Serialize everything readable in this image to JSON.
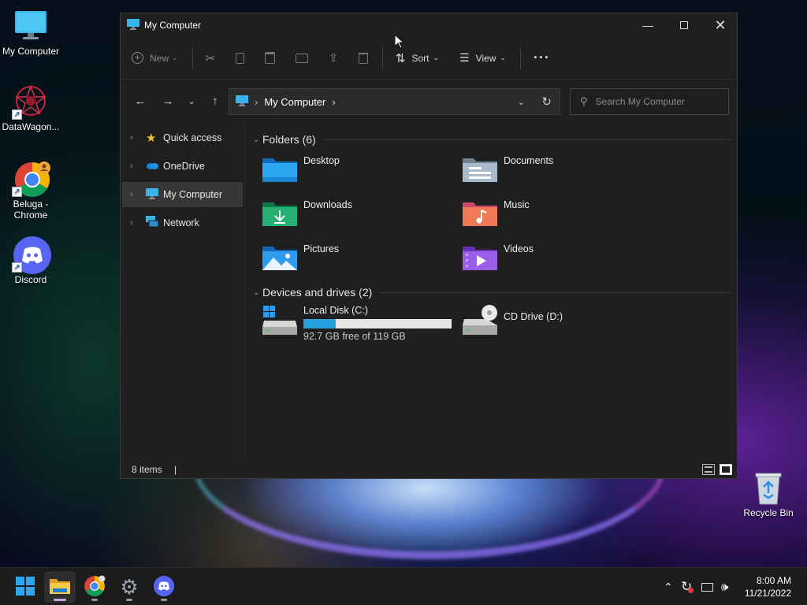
{
  "desktop": {
    "icons": [
      {
        "label": "My Computer",
        "icon": "monitor-icon"
      },
      {
        "label": "DataWagon...",
        "icon": "datawagon-icon"
      },
      {
        "label": "Beluga - Chrome",
        "icon": "chrome-icon"
      },
      {
        "label": "Discord",
        "icon": "discord-icon"
      },
      {
        "label": "Recycle Bin",
        "icon": "recycle-bin-icon"
      }
    ]
  },
  "window": {
    "title": "My Computer",
    "toolbar": {
      "new_label": "New",
      "sort_label": "Sort",
      "view_label": "View",
      "more_label": "···"
    },
    "address": {
      "location": "My Computer",
      "search_placeholder": "Search My Computer"
    },
    "sidebar": {
      "items": [
        {
          "label": "Quick access",
          "icon": "star-icon"
        },
        {
          "label": "OneDrive",
          "icon": "cloud-icon"
        },
        {
          "label": "My Computer",
          "icon": "monitor-icon",
          "selected": true
        },
        {
          "label": "Network",
          "icon": "network-icon"
        }
      ]
    },
    "folders_group": {
      "title": "Folders (6)",
      "items": [
        {
          "label": "Desktop",
          "icon": "desktop-folder-icon",
          "color": "#1e88d8"
        },
        {
          "label": "Documents",
          "icon": "documents-folder-icon",
          "color": "#8da3b8"
        },
        {
          "label": "Downloads",
          "icon": "downloads-folder-icon",
          "color": "#1fa86a"
        },
        {
          "label": "Music",
          "icon": "music-folder-icon",
          "color": "#e46d4e"
        },
        {
          "label": "Pictures",
          "icon": "pictures-folder-icon",
          "color": "#2a8ee6"
        },
        {
          "label": "Videos",
          "icon": "videos-folder-icon",
          "color": "#8d4fd6"
        }
      ]
    },
    "drives_group": {
      "title": "Devices and drives (2)",
      "drives": [
        {
          "label": "Local Disk (C:)",
          "free_text": "92.7 GB free of 119 GB",
          "used_fraction": 0.22
        },
        {
          "label": "CD Drive (D:)"
        }
      ]
    },
    "status": {
      "items_text": "8 items",
      "cursor_text": "|"
    }
  },
  "taskbar": {
    "apps": [
      "start-icon",
      "file-explorer-icon",
      "chrome-icon",
      "settings-icon",
      "discord-icon"
    ],
    "clock": {
      "time": "8:00 AM",
      "date": "11/21/2022"
    }
  }
}
